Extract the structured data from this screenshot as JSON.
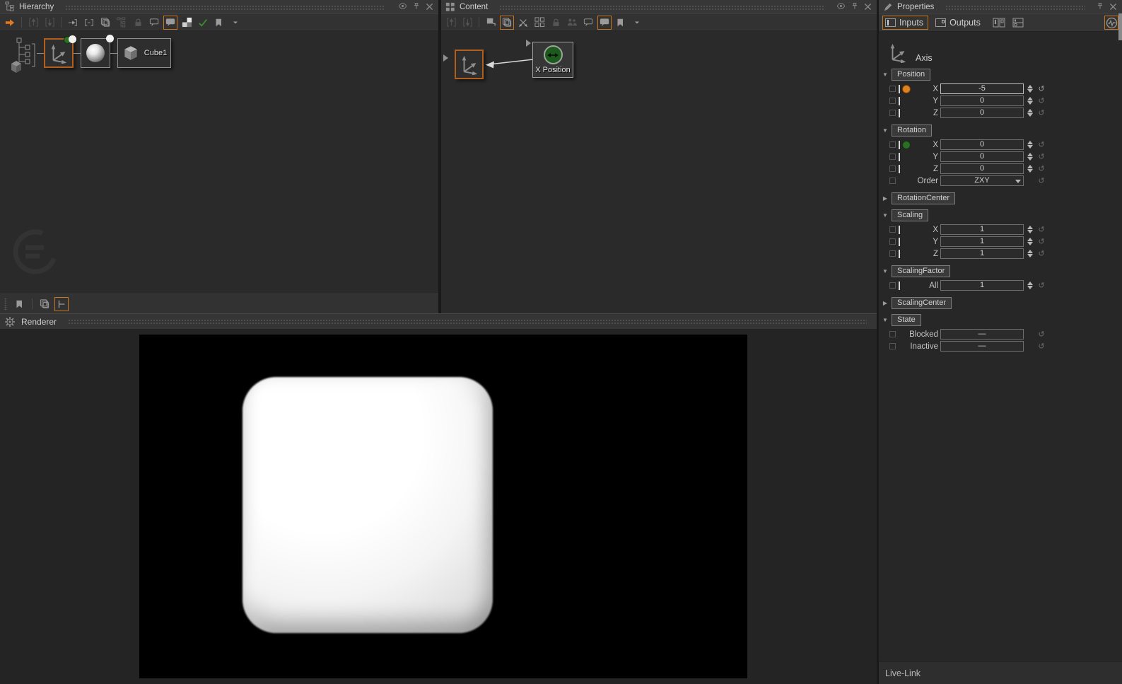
{
  "accent_color": "#e07c1d",
  "hierarchy": {
    "title": "Hierarchy",
    "toolbar": [
      {
        "icon": "jump-arrow",
        "state": "accent"
      },
      {
        "div": true
      },
      {
        "icon": "import-up",
        "state": "dim"
      },
      {
        "icon": "import-down",
        "state": "dim"
      },
      {
        "div": true
      },
      {
        "icon": "arrow-into-bracket",
        "state": "normal"
      },
      {
        "icon": "collapse-bracket",
        "state": "normal"
      },
      {
        "icon": "layers",
        "state": "normal"
      },
      {
        "icon": "subtree",
        "state": "dim"
      },
      {
        "icon": "lock",
        "state": "dim"
      },
      {
        "icon": "comment-outline",
        "state": "normal"
      },
      {
        "icon": "comment-filled",
        "state": "sel"
      },
      {
        "icon": "checkerboard",
        "state": "normal"
      },
      {
        "icon": "check",
        "state": "green"
      },
      {
        "icon": "bookmark",
        "state": "normal"
      },
      {
        "icon": "caret-down",
        "state": "normal"
      }
    ],
    "bottom_toolbar": [
      {
        "icon": "bookmark",
        "state": "normal"
      },
      {
        "div": true
      },
      {
        "icon": "layers",
        "state": "normal"
      },
      {
        "icon": "tree-toggle",
        "state": "sel"
      }
    ],
    "nodes": {
      "cube_label": "Cube1"
    }
  },
  "content": {
    "title": "Content",
    "toolbar": [
      {
        "icon": "import-up",
        "state": "dim"
      },
      {
        "icon": "import-down",
        "state": "dim"
      },
      {
        "div": true
      },
      {
        "icon": "flag-pin",
        "state": "normal"
      },
      {
        "icon": "layers",
        "state": "sel"
      },
      {
        "icon": "cross-arrows",
        "state": "normal"
      },
      {
        "icon": "grid",
        "state": "normal"
      },
      {
        "icon": "lock",
        "state": "dim"
      },
      {
        "icon": "people",
        "state": "dim"
      },
      {
        "icon": "comment-outline",
        "state": "normal"
      },
      {
        "icon": "comment-filled",
        "state": "sel"
      },
      {
        "icon": "bookmark",
        "state": "normal"
      },
      {
        "icon": "caret-down",
        "state": "normal"
      }
    ],
    "node_label": "X Position"
  },
  "properties": {
    "title": "Properties",
    "tabs": [
      {
        "label": "Inputs",
        "selected": true
      },
      {
        "label": "Outputs",
        "selected": false
      }
    ],
    "object_name": "Axis",
    "sections": [
      {
        "label": "Position",
        "expanded": true,
        "rows": [
          {
            "label": "X",
            "value": "-5",
            "bar": true,
            "dot": "orange",
            "spinner": true,
            "highlight": true,
            "resetBright": true
          },
          {
            "label": "Y",
            "value": "0",
            "bar": true,
            "spinner": true
          },
          {
            "label": "Z",
            "value": "0",
            "bar": true,
            "spinner": true
          }
        ]
      },
      {
        "label": "Rotation",
        "expanded": true,
        "rows": [
          {
            "label": "X",
            "value": "0",
            "bar": true,
            "dot": "green",
            "spinner": true
          },
          {
            "label": "Y",
            "value": "0",
            "bar": true,
            "spinner": true
          },
          {
            "label": "Z",
            "value": "0",
            "bar": true,
            "spinner": true
          },
          {
            "label": "Order",
            "value": "ZXY",
            "dropdown": true
          }
        ]
      },
      {
        "label": "RotationCenter",
        "expanded": false,
        "rows": []
      },
      {
        "label": "Scaling",
        "expanded": true,
        "rows": [
          {
            "label": "X",
            "value": "1",
            "bar": true,
            "spinner": true
          },
          {
            "label": "Y",
            "value": "1",
            "bar": true,
            "spinner": true
          },
          {
            "label": "Z",
            "value": "1",
            "bar": true,
            "spinner": true
          }
        ]
      },
      {
        "label": "ScalingFactor",
        "expanded": true,
        "rows": [
          {
            "label": "All",
            "value": "1",
            "bar": true,
            "spinner": true
          }
        ]
      },
      {
        "label": "ScalingCenter",
        "expanded": false,
        "rows": []
      },
      {
        "label": "State",
        "expanded": true,
        "rows": [
          {
            "label": "Blocked",
            "value": "—"
          },
          {
            "label": "Inactive",
            "value": "—"
          }
        ]
      }
    ]
  },
  "renderer": {
    "title": "Renderer"
  },
  "livelink": {
    "title": "Live-Link"
  }
}
